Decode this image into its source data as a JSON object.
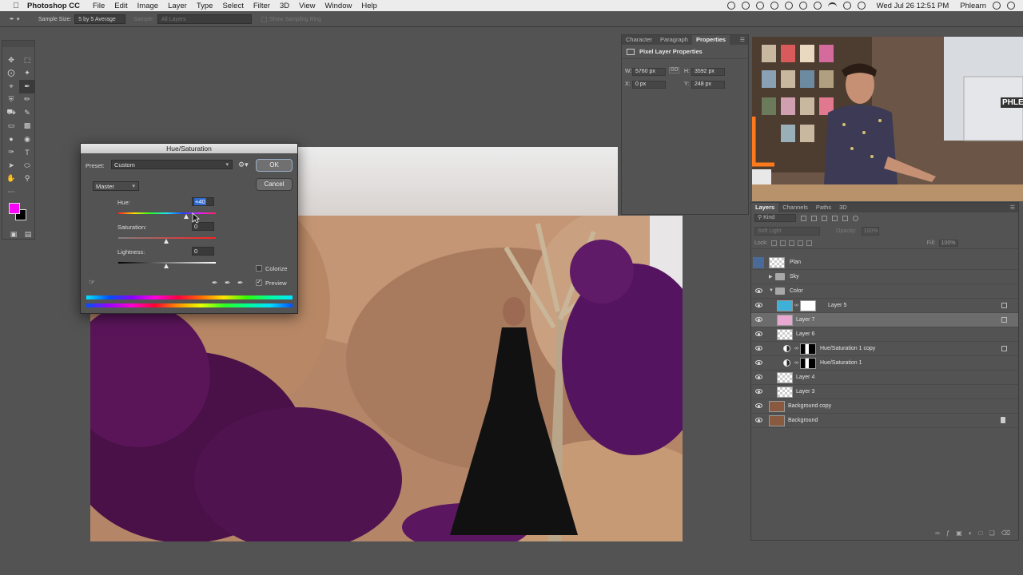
{
  "menubar": {
    "app_name": "Photoshop CC",
    "items": [
      "File",
      "Edit",
      "Image",
      "Layer",
      "Type",
      "Select",
      "Filter",
      "3D",
      "View",
      "Window",
      "Help"
    ],
    "clock": "Wed Jul 26  12:51 PM",
    "user": "Phlearn"
  },
  "options": {
    "sample_size_label": "Sample Size:",
    "sample_size_value": "5 by 5 Average",
    "sample_label": "Sample:",
    "sample_value": "All Layers",
    "show_ring_label": "Show Sampling Ring"
  },
  "dialog": {
    "title": "Hue/Saturation",
    "preset_label": "Preset:",
    "preset_value": "Custom",
    "channel_value": "Master",
    "ok_label": "OK",
    "cancel_label": "Cancel",
    "hue_label": "Hue:",
    "hue_value": "+40",
    "saturation_label": "Saturation:",
    "saturation_value": "0",
    "lightness_label": "Lightness:",
    "lightness_value": "0",
    "colorize_label": "Colorize",
    "preview_label": "Preview",
    "preview_checked": true,
    "colorize_checked": false
  },
  "properties": {
    "tabs": [
      "Character",
      "Paragraph",
      "Properties"
    ],
    "active_tab": "Properties",
    "heading": "Pixel Layer Properties",
    "w_label": "W:",
    "w_value": "5760 px",
    "h_label": "H:",
    "h_value": "3592 px",
    "x_label": "X:",
    "x_value": "0 px",
    "y_label": "Y:",
    "y_value": "248 px",
    "link_glyph": "GO"
  },
  "layers": {
    "tabs": [
      "Layers",
      "Channels",
      "Paths",
      "3D"
    ],
    "filter_kind": "Kind",
    "blend_mode": "Soft Light",
    "opacity_label": "Opacity:",
    "opacity_value": "100%",
    "lock_label": "Lock:",
    "fill_label": "Fill:",
    "fill_value": "100%",
    "rows": [
      {
        "name": "Plan"
      },
      {
        "name": "Sky"
      },
      {
        "name": "Color"
      },
      {
        "name": "Layer 5"
      },
      {
        "name": "Layer 7"
      },
      {
        "name": "Layer 6"
      },
      {
        "name": "Hue/Saturation 1 copy"
      },
      {
        "name": "Hue/Saturation 1"
      },
      {
        "name": "Layer 4"
      },
      {
        "name": "Layer 3"
      },
      {
        "name": "Background copy"
      },
      {
        "name": "Background"
      }
    ]
  },
  "webcam": {
    "sign_text": "PHLEA"
  },
  "colors": {
    "foreground": "#ff00ff",
    "background": "#000000",
    "panel": "#535353"
  }
}
